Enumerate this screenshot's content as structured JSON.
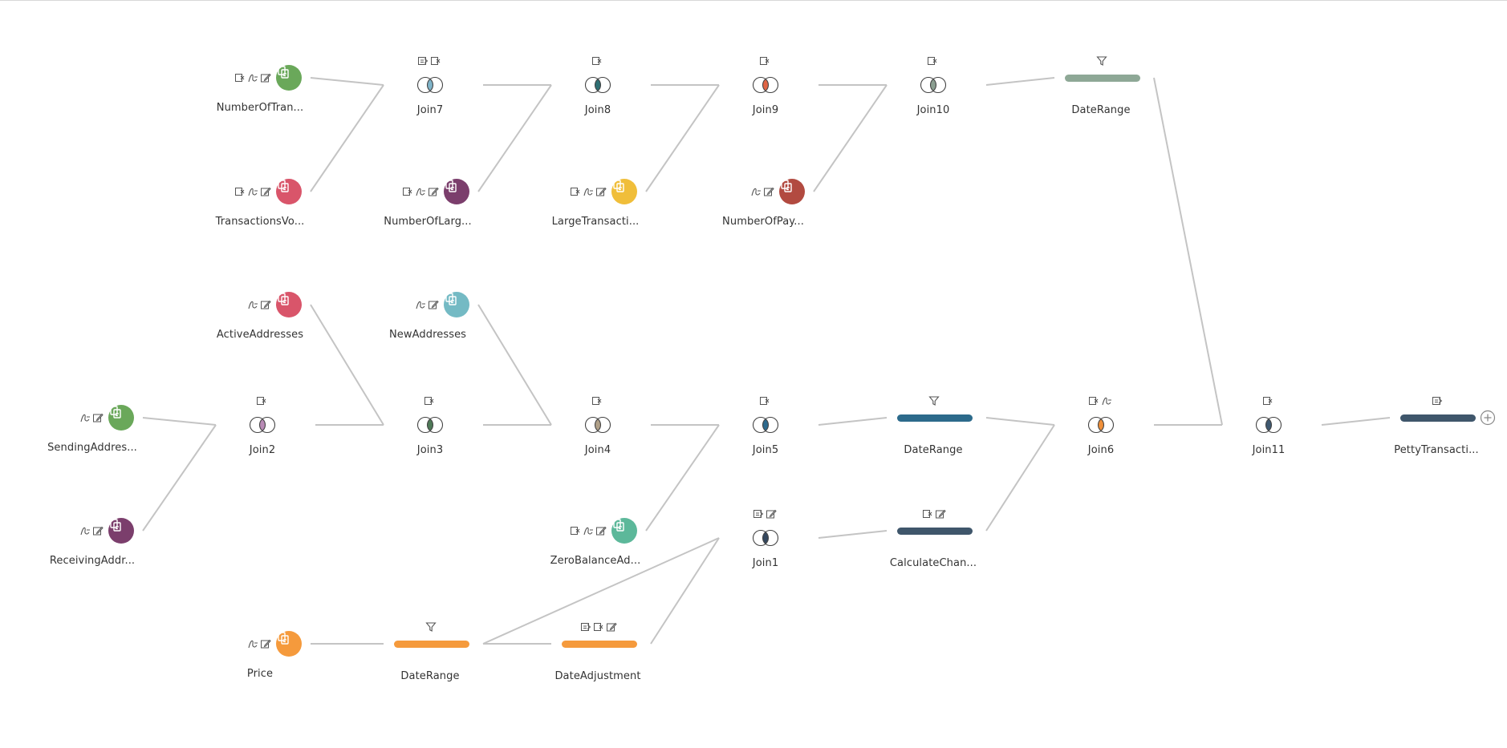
{
  "canvas": {
    "background": "#ffffff",
    "line_color": "#c4c4c4"
  },
  "nodes": {
    "n_tx": {
      "label": "NumberOfTran...",
      "kind": "input",
      "color": "#6aa85a",
      "icons": [
        "remove-icon",
        "calc-icon",
        "rename-icon"
      ]
    },
    "n_txv": {
      "label": "TransactionsVo...",
      "kind": "input",
      "color": "#d9556a",
      "icons": [
        "remove-icon",
        "calc-icon",
        "rename-icon"
      ]
    },
    "n_join7": {
      "label": "Join7",
      "kind": "join",
      "color": "#7fb4c9",
      "icons": [
        "keep-icon",
        "remove-icon"
      ]
    },
    "n_nlarge": {
      "label": "NumberOfLarg...",
      "kind": "input",
      "color": "#7b3e6c",
      "icons": [
        "remove-icon",
        "calc-icon",
        "rename-icon"
      ]
    },
    "n_join8": {
      "label": "Join8",
      "kind": "join",
      "color": "#2e6f73",
      "icons": [
        "remove-icon"
      ]
    },
    "n_large": {
      "label": "LargeTransacti...",
      "kind": "input",
      "color": "#f0be3a",
      "icons": [
        "remove-icon",
        "calc-icon",
        "rename-icon"
      ]
    },
    "n_join9": {
      "label": "Join9",
      "kind": "join",
      "color": "#e06545",
      "icons": [
        "remove-icon"
      ]
    },
    "n_npay": {
      "label": "NumberOfPay...",
      "kind": "input",
      "color": "#b24a40",
      "icons": [
        "calc-icon",
        "rename-icon"
      ]
    },
    "n_join10": {
      "label": "Join10",
      "kind": "join",
      "color": "#8a9e90",
      "icons": [
        "remove-icon"
      ]
    },
    "n_dr_top": {
      "label": "DateRange",
      "kind": "filter",
      "color": "#8ea896",
      "icons": [
        "filter-icon"
      ]
    },
    "n_active": {
      "label": "ActiveAddresses",
      "kind": "input",
      "color": "#d9556a",
      "icons": [
        "calc-icon",
        "rename-icon"
      ]
    },
    "n_new": {
      "label": "NewAddresses",
      "kind": "input",
      "color": "#74bac4",
      "icons": [
        "calc-icon",
        "rename-icon"
      ]
    },
    "n_send": {
      "label": "SendingAddres...",
      "kind": "input",
      "color": "#6aa85a",
      "icons": [
        "calc-icon",
        "rename-icon"
      ]
    },
    "n_join2": {
      "label": "Join2",
      "kind": "join",
      "color": "#b98bb6",
      "icons": [
        "remove-icon"
      ]
    },
    "n_join3": {
      "label": "Join3",
      "kind": "join",
      "color": "#4f7a58",
      "icons": [
        "remove-icon"
      ]
    },
    "n_join4": {
      "label": "Join4",
      "kind": "join",
      "color": "#b0a088",
      "icons": [
        "remove-icon"
      ]
    },
    "n_join5": {
      "label": "Join5",
      "kind": "join",
      "color": "#2d6a8e",
      "icons": [
        "remove-icon"
      ]
    },
    "n_dr_mid": {
      "label": "DateRange",
      "kind": "filter",
      "color": "#2c6a8b",
      "icons": [
        "filter-icon"
      ]
    },
    "n_join6": {
      "label": "Join6",
      "kind": "join",
      "color": "#f0903a",
      "icons": [
        "remove-icon",
        "calc-icon"
      ]
    },
    "n_join11": {
      "label": "Join11",
      "kind": "join",
      "color": "#3e5870",
      "icons": [
        "remove-icon"
      ]
    },
    "n_petty": {
      "label": "PettyTransacti...",
      "kind": "output",
      "color": "#3f566b",
      "icons": [
        "keep-icon"
      ]
    },
    "n_recv": {
      "label": "ReceivingAddr...",
      "kind": "input",
      "color": "#7b3e6c",
      "icons": [
        "calc-icon",
        "rename-icon"
      ]
    },
    "n_zero": {
      "label": "ZeroBalanceAd...",
      "kind": "input",
      "color": "#5cb89a",
      "icons": [
        "remove-icon",
        "calc-icon",
        "rename-icon"
      ]
    },
    "n_join1": {
      "label": "Join1",
      "kind": "join",
      "color": "#34475e",
      "icons": [
        "keep-icon",
        "rename-icon"
      ]
    },
    "n_calc": {
      "label": "CalculateChan...",
      "kind": "clean",
      "color": "#3f566b",
      "icons": [
        "remove-icon",
        "rename-icon"
      ]
    },
    "n_price": {
      "label": "Price",
      "kind": "input",
      "color": "#f59a3c",
      "icons": [
        "calc-icon",
        "rename-icon"
      ]
    },
    "n_dr_bot": {
      "label": "DateRange",
      "kind": "filter",
      "color": "#f59a3c",
      "icons": [
        "filter-icon"
      ]
    },
    "n_dateadj": {
      "label": "DateAdjustment",
      "kind": "clean",
      "color": "#f59a3c",
      "icons": [
        "keep-icon",
        "remove-icon",
        "rename-icon"
      ]
    }
  },
  "edges": [
    [
      "n_tx",
      "n_join7"
    ],
    [
      "n_txv",
      "n_join7"
    ],
    [
      "n_join7",
      "n_join8"
    ],
    [
      "n_nlarge",
      "n_join8"
    ],
    [
      "n_join8",
      "n_join9"
    ],
    [
      "n_large",
      "n_join9"
    ],
    [
      "n_join9",
      "n_join10"
    ],
    [
      "n_npay",
      "n_join10"
    ],
    [
      "n_join10",
      "n_dr_top"
    ],
    [
      "n_dr_top",
      "n_join11"
    ],
    [
      "n_send",
      "n_join2"
    ],
    [
      "n_recv",
      "n_join2"
    ],
    [
      "n_join2",
      "n_join3"
    ],
    [
      "n_active",
      "n_join3"
    ],
    [
      "n_join3",
      "n_join4"
    ],
    [
      "n_new",
      "n_join4"
    ],
    [
      "n_join4",
      "n_join5"
    ],
    [
      "n_zero",
      "n_join5"
    ],
    [
      "n_join5",
      "n_dr_mid"
    ],
    [
      "n_dr_mid",
      "n_join6"
    ],
    [
      "n_price",
      "n_dr_bot"
    ],
    [
      "n_dr_bot",
      "n_dateadj"
    ],
    [
      "n_dr_bot",
      "n_join1"
    ],
    [
      "n_dateadj",
      "n_join1"
    ],
    [
      "n_join1",
      "n_calc"
    ],
    [
      "n_calc",
      "n_join6"
    ],
    [
      "n_join6",
      "n_join11"
    ],
    [
      "n_join11",
      "n_petty"
    ]
  ],
  "add_step_icon": "plus-icon"
}
